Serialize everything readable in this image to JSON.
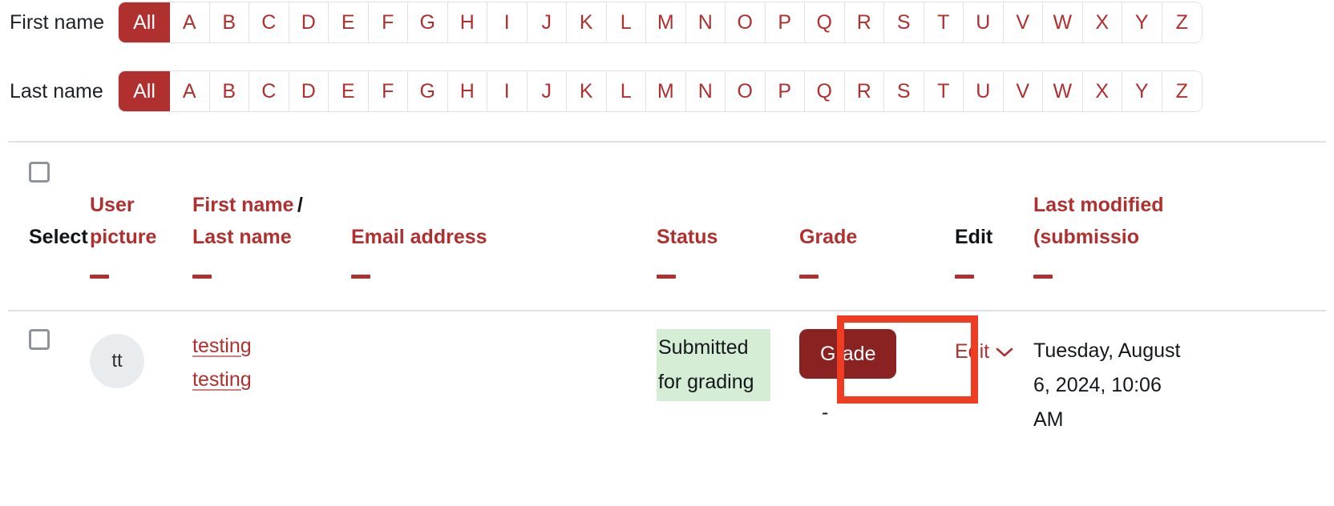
{
  "filters": [
    {
      "id": "first-name",
      "label": "First name",
      "all_label": "All",
      "active": "All",
      "letters": [
        "A",
        "B",
        "C",
        "D",
        "E",
        "F",
        "G",
        "H",
        "I",
        "J",
        "K",
        "L",
        "M",
        "N",
        "O",
        "P",
        "Q",
        "R",
        "S",
        "T",
        "U",
        "V",
        "W",
        "X",
        "Y",
        "Z"
      ]
    },
    {
      "id": "last-name",
      "label": "Last name",
      "all_label": "All",
      "active": "All",
      "letters": [
        "A",
        "B",
        "C",
        "D",
        "E",
        "F",
        "G",
        "H",
        "I",
        "J",
        "K",
        "L",
        "M",
        "N",
        "O",
        "P",
        "Q",
        "R",
        "S",
        "T",
        "U",
        "V",
        "W",
        "X",
        "Y",
        "Z"
      ]
    }
  ],
  "table": {
    "headers": {
      "select": "Select",
      "user_picture": "User picture",
      "first_name": "First name",
      "name_separator": "/",
      "last_name": "Last name",
      "email": "Email address",
      "status": "Status",
      "grade": "Grade",
      "edit": "Edit",
      "last_modified": "Last modified (submissio"
    },
    "rows": [
      {
        "first_name": "testing",
        "last_name": "testing",
        "avatar_initials": "tt",
        "email": "",
        "status": "Submitted for grading",
        "grade_button": "Grade",
        "grade_value": "-",
        "edit": "Edit",
        "edit_chevron": "chevron-down",
        "last_modified": "Tuesday, August 6, 2024, 10:06 AM"
      }
    ]
  },
  "colors": {
    "accent_red": "#b0302f",
    "button_maroon": "#8b2222",
    "highlight_orange": "#ee3d22",
    "status_green_bg": "#d4edd4",
    "avatar_bg": "#e9ecef",
    "divider": "#dee2e6"
  }
}
